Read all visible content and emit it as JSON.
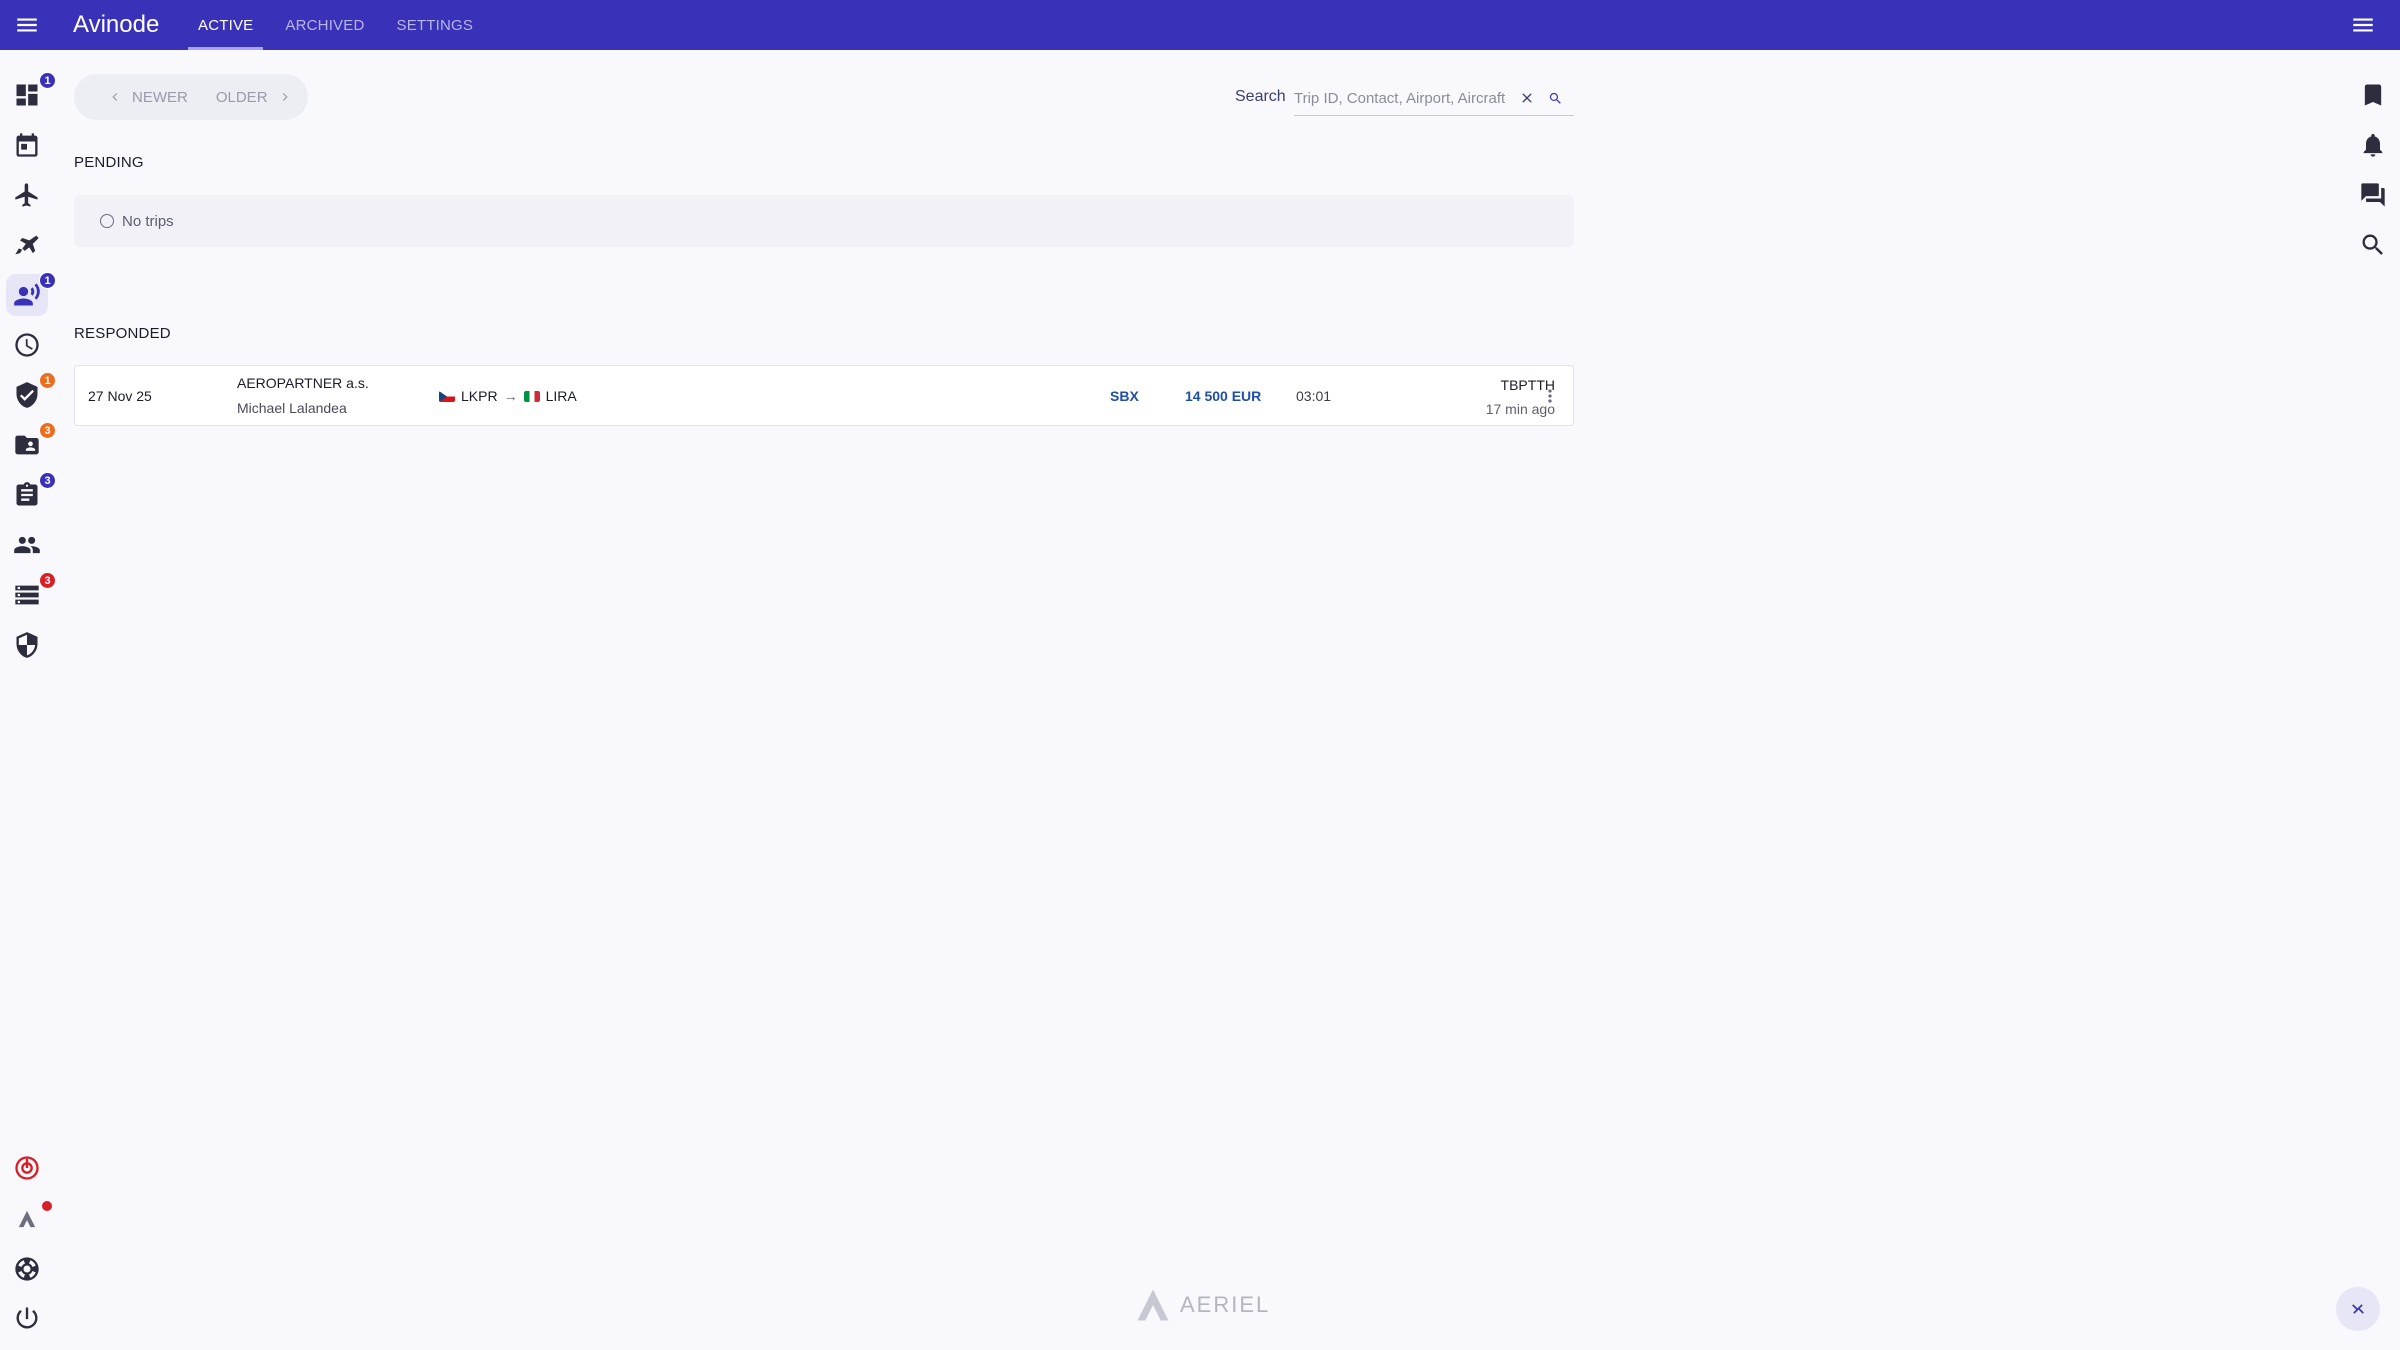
{
  "app": {
    "brand": "Avinode",
    "tabs": [
      {
        "label": "ACTIVE",
        "active": true
      },
      {
        "label": "ARCHIVED",
        "active": false
      },
      {
        "label": "SETTINGS",
        "active": false
      }
    ]
  },
  "leftnav": {
    "badges": {
      "dashboard": "1",
      "requests": "1",
      "verified": "1",
      "folder": "3",
      "clipboard": "3",
      "list": "3"
    }
  },
  "pager": {
    "newer_label": "NEWER",
    "older_label": "OLDER"
  },
  "search": {
    "label": "Search",
    "placeholder": "Trip ID, Contact, Airport, Aircraft",
    "value": ""
  },
  "pending": {
    "title": "PENDING",
    "empty_text": "No trips"
  },
  "responded": {
    "title": "RESPONDED",
    "trips": [
      {
        "date": "27 Nov 25",
        "company": "AEROPARTNER a.s.",
        "contact": "Michael Lalandea",
        "from": "LKPR",
        "arrow": "→",
        "to": "LIRA",
        "aircraft": "SBX",
        "price": "14 500 EUR",
        "duration": "03:01",
        "registration": "TBPTTH",
        "ago": "17 min ago"
      }
    ]
  },
  "footer": {
    "logo_text": "AERIEL"
  },
  "colors": {
    "topbar": "#3932b9",
    "accent_blue": "#1f4fa8",
    "badge_orange": "#ef6c1f",
    "badge_red": "#d91f26"
  }
}
